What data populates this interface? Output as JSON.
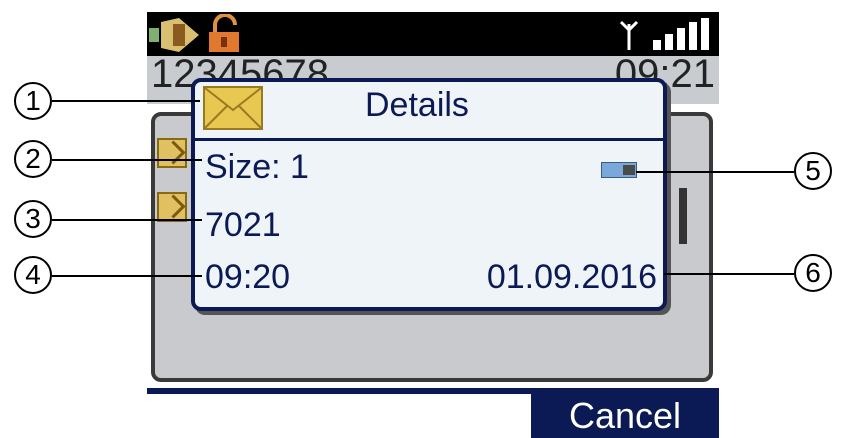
{
  "status_bar": {
    "left_icons": [
      "battery-icon",
      "lock-icon"
    ],
    "right_icons": [
      "antenna-icon",
      "signal-strength-icon"
    ]
  },
  "info_bar": {
    "number": "12345678",
    "time": "09:21"
  },
  "dialog": {
    "title": "Details",
    "title_icon": "envelope-icon",
    "size": "Size: 1",
    "sender": "7021",
    "time": "09:20",
    "date": "01.09.2016",
    "storage_icon": "memory-icon"
  },
  "softkeys": {
    "right": "Cancel"
  },
  "callouts": [
    "1",
    "2",
    "3",
    "4",
    "5",
    "6"
  ],
  "colors": {
    "accent": "#0b1a55",
    "dialog_bg": "#eef4f8",
    "panel_gray": "#c8cacd",
    "envelope": "#e8c850"
  }
}
